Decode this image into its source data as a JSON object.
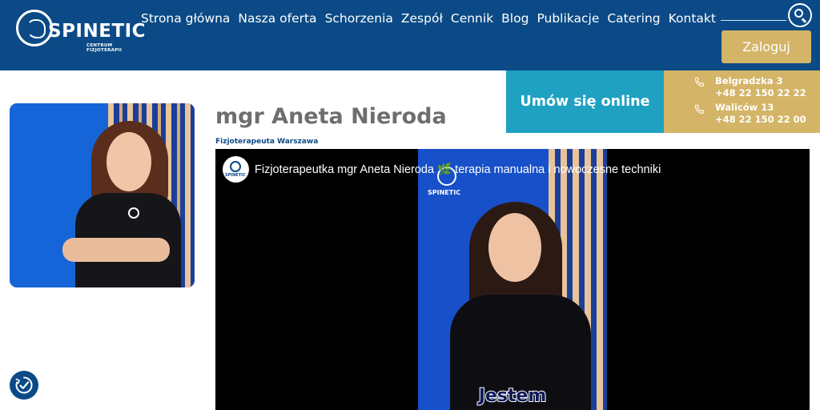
{
  "header": {
    "logo": {
      "name": "SPINETIC",
      "subtitle": "CENTRUM FIZJOTERAPII"
    },
    "nav": [
      {
        "label": "Strona główna"
      },
      {
        "label": "Nasza oferta"
      },
      {
        "label": "Schorzenia"
      },
      {
        "label": "Zespół"
      },
      {
        "label": "Cennik"
      },
      {
        "label": "Blog"
      },
      {
        "label": "Publikacje"
      },
      {
        "label": "Catering"
      },
      {
        "label": "Kontakt"
      }
    ],
    "search_icon": "search-icon",
    "login_label": "Zaloguj"
  },
  "booking": {
    "online_label": "Umów się online",
    "locations": [
      {
        "street": "Belgradzka 3",
        "phone": "+48 22 150 22 22"
      },
      {
        "street": "Waliców 13",
        "phone": "+48 22 150 22 00"
      }
    ]
  },
  "profile": {
    "name": "mgr Aneta Nieroda",
    "role": "Fizjoterapeuta Warszawa"
  },
  "video": {
    "title": "Fizjoterapeutka mgr Aneta Nieroda 🌿 terapia manualna i nowoczesne techniki",
    "channel_logo_text": "SPINETIC",
    "frame_logo_text": "SPINETIC",
    "caption": "Jestem"
  },
  "colors": {
    "header_bg": "#0b4a86",
    "gold": "#d4b567",
    "teal": "#1fa1c2"
  }
}
